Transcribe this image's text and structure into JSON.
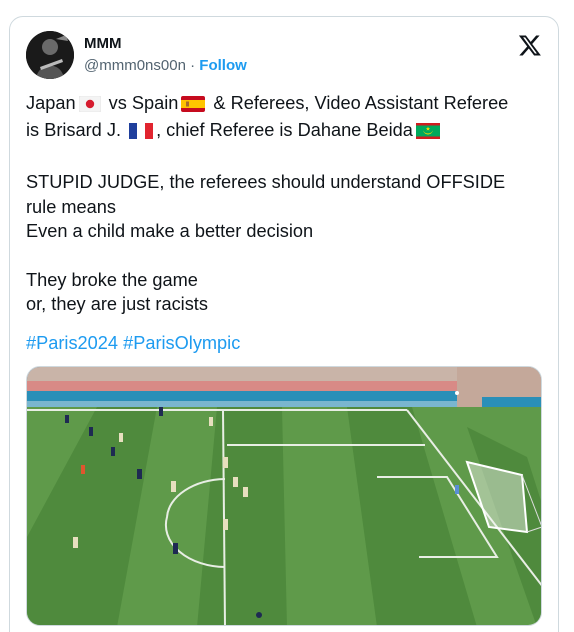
{
  "author": {
    "display_name": "MMM",
    "handle": "@mmm0ns00n",
    "separator": "·",
    "follow_label": "Follow"
  },
  "post": {
    "line1_a": "Japan",
    "line1_b": " vs Spain",
    "line1_c": " & Referees, Video Assistant Referee",
    "line2_a": "is Brisard J. ",
    "line2_b": ", chief Referee is Dahane Beida",
    "line3": "STUPID JUDGE, the referees should understand OFFSIDE",
    "line4": "rule means",
    "line5": "Even a child make a better decision",
    "line6": "They broke the game",
    "line7": "or, they are just racists",
    "hashtag1": "#Paris2024",
    "hashtag2": "#ParisOlympic"
  },
  "flags": [
    "japan-flag-icon",
    "spain-flag-icon",
    "france-flag-icon",
    "mauritania-flag-icon"
  ],
  "colors": {
    "link": "#1d9bf0",
    "text": "#0f1419",
    "secondary": "#536471",
    "border": "#cfd9de",
    "pitch_light": "#5f9a4a",
    "pitch_dark": "#4f8a3d"
  }
}
